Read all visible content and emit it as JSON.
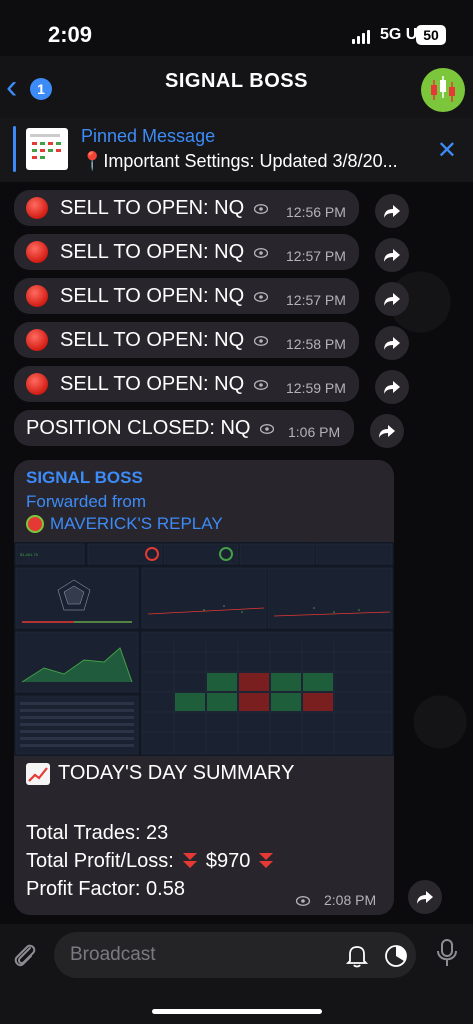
{
  "status": {
    "time": "2:09",
    "network": "5G UC",
    "battery": "50"
  },
  "header": {
    "back_count": "1",
    "title": "SIGNAL BOSS"
  },
  "pinned": {
    "title": "Pinned Message",
    "text": "📍Important Settings: Updated 3/8/20..."
  },
  "messages": [
    {
      "text": "SELL TO OPEN: NQ",
      "time": "12:56 PM"
    },
    {
      "text": "SELL TO OPEN: NQ",
      "time": "12:57 PM"
    },
    {
      "text": "SELL TO OPEN: NQ",
      "time": "12:57 PM"
    },
    {
      "text": "SELL TO OPEN: NQ",
      "time": "12:58 PM"
    },
    {
      "text": "SELL TO OPEN: NQ",
      "time": "12:59 PM"
    },
    {
      "text": "POSITION CLOSED: NQ",
      "time": "1:06 PM"
    }
  ],
  "forwarded": {
    "channel": "SIGNAL BOSS",
    "forwarded_label": "Forwarded from",
    "source": "MAVERICK'S REPLAY",
    "summary_title": "TODAY'S DAY SUMMARY",
    "total_trades": "Total Trades: 23",
    "profit_loss_label": "Total Profit/Loss:",
    "profit_loss_value": "$970",
    "profit_factor": "Profit Factor: 0.58",
    "time": "2:08 PM"
  },
  "composer": {
    "placeholder": "Broadcast"
  },
  "colors": {
    "accent": "#3d8bf7",
    "bubble": "#28262c",
    "sell_dot": "#d31d14"
  },
  "icons": [
    "back-chevron-icon",
    "close-icon",
    "eye-icon",
    "share-arrow-icon",
    "paperclip-icon",
    "bell-icon",
    "clock-icon",
    "microphone-icon",
    "chart-up-icon",
    "down-arrows-icon"
  ]
}
